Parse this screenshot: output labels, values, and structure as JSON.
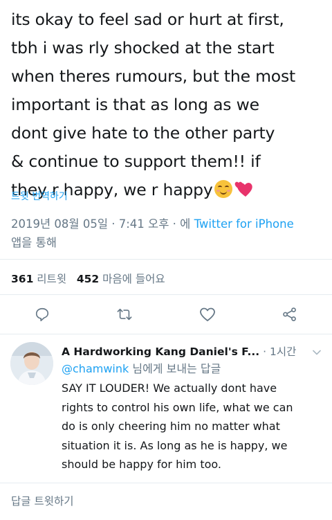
{
  "tweet": {
    "lines": [
      "its okay to feel sad or hurt at first,",
      "tbh i was rly shocked at the start",
      "when theres rumours, but the most",
      "important is that as long as we",
      "dont give hate to the other party",
      "& continue to support them!! if",
      "they r happy, we r happy"
    ],
    "emoji": [
      "smiling-face-emoji",
      "two-hearts-emoji"
    ]
  },
  "translate_label": "트윗 번역하기",
  "meta": {
    "datetime": "2019년 08월 05일 · 7:41 오후 · 에 ",
    "source": "Twitter for iPhone",
    "suffix": "앱을 통해"
  },
  "stats": {
    "retweets": "361",
    "retweets_label": "리트윗",
    "likes": "452",
    "likes_label": "마음에 들어요"
  },
  "actions": [
    "reply-icon",
    "retweet-icon",
    "like-icon",
    "share-icon"
  ],
  "reply": {
    "name": "A Hardworking Kang Daniel's F...",
    "dot": " · ",
    "time": "1시간",
    "handle": "@chamwink",
    "reply_to_suffix": " 님에게 보내는 답글",
    "lines": [
      "SAY IT LOUDER! We actually dont have",
      "rights to control his own life, what we can",
      "do is only cheering him no matter what",
      "situation it is. As long as he is happy, we",
      "should be happy for him too."
    ]
  },
  "reply_box_label": "답글 트윗하기",
  "colors": {
    "accent": "#1da1f2",
    "text": "#14171a",
    "muted": "#657786",
    "divider": "#e6ecf0"
  }
}
